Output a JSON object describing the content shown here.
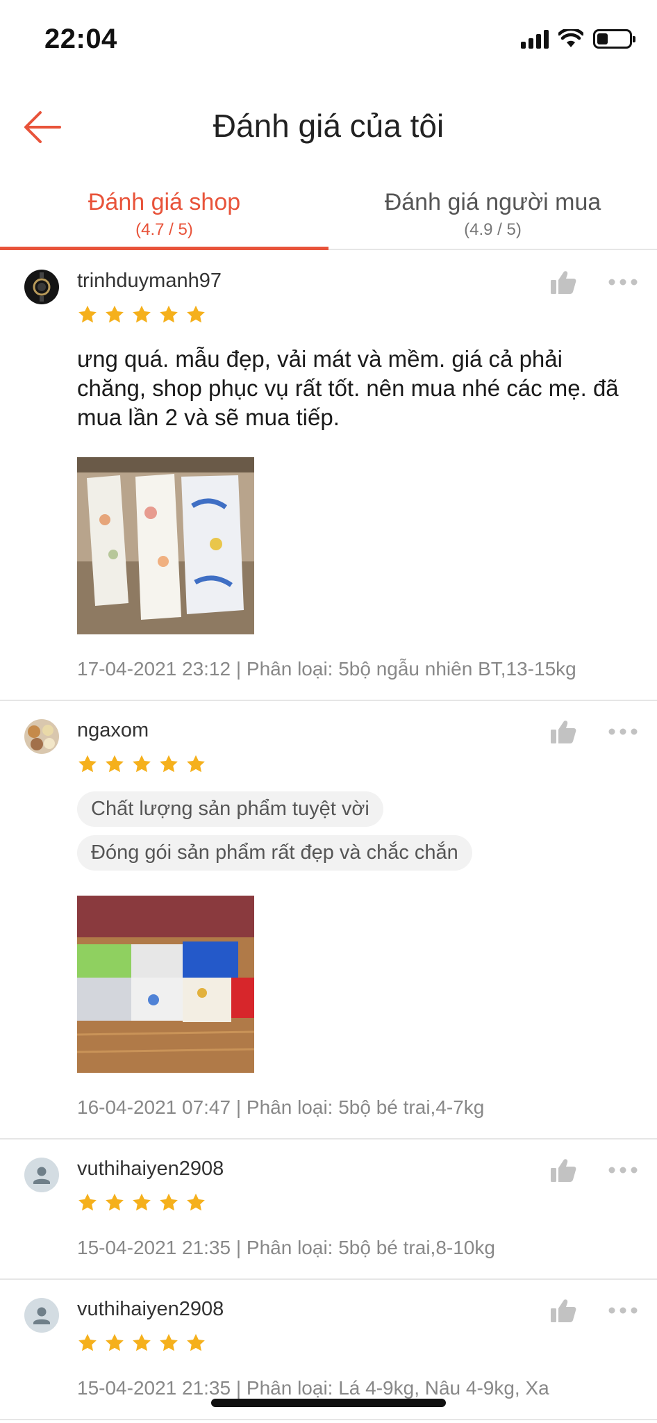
{
  "status_bar": {
    "time": "22:04"
  },
  "header": {
    "title": "Đánh giá của tôi"
  },
  "tabs": [
    {
      "label": "Đánh giá shop",
      "score": "(4.7 / 5)",
      "active": true
    },
    {
      "label": "Đánh giá người mua",
      "score": "(4.9 / 5)",
      "active": false
    }
  ],
  "reviews": [
    {
      "username": "trinhduymanh97",
      "rating": 5,
      "comment": "ưng quá. mẫu đẹp, vải mát và mềm. giá cả phải chăng,  shop phục vụ rất tốt. nên mua nhé các mẹ. đã mua lần 2 và sẽ mua tiếp.",
      "meta": "17-04-2021 23:12 | Phân loại: 5bộ ngẫu nhiên BT,13-15kg"
    },
    {
      "username": "ngaxom",
      "rating": 5,
      "tags": [
        "Chất lượng sản phẩm tuyệt vời",
        "Đóng gói sản phẩm rất đẹp và chắc chắn"
      ],
      "meta": "16-04-2021 07:47 | Phân loại: 5bộ bé trai,4-7kg"
    },
    {
      "username": "vuthihaiyen2908",
      "rating": 5,
      "meta": "15-04-2021 21:35 | Phân loại: 5bộ bé trai,8-10kg"
    },
    {
      "username": "vuthihaiyen2908",
      "rating": 5,
      "meta": "15-04-2021 21:35 | Phân loại: Lá 4-9kg, Nâu 4-9kg, Xa"
    }
  ],
  "colors": {
    "accent": "#e8533a",
    "star": "#f5b01c",
    "divider": "#e6e6e6",
    "muted": "#888888"
  },
  "icons": {
    "back": "arrow-left-icon",
    "like": "thumbs-up-icon",
    "more": "more-dots-icon",
    "star": "star-icon"
  }
}
